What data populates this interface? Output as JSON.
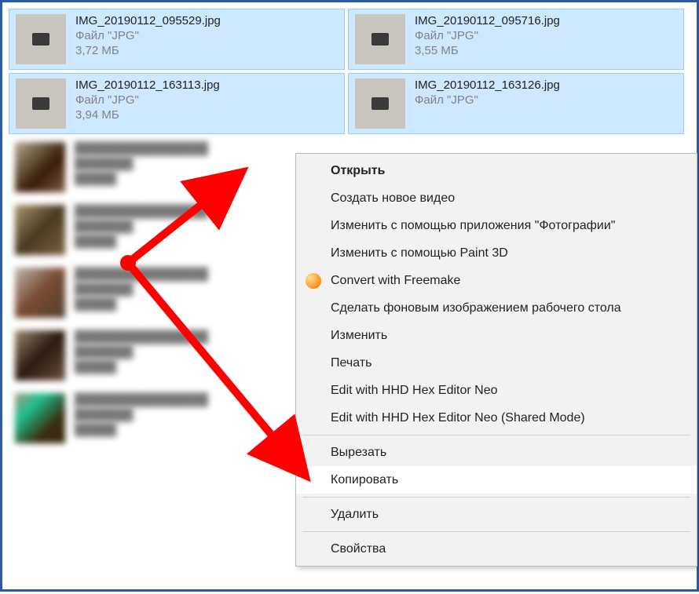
{
  "files": [
    {
      "name": "IMG_20190112_095529.jpg",
      "type": "Файл \"JPG\"",
      "size": "3,72 МБ",
      "selected": true
    },
    {
      "name": "IMG_20190112_095716.jpg",
      "type": "Файл \"JPG\"",
      "size": "3,55 МБ",
      "selected": true
    },
    {
      "name": "IMG_20190112_163113.jpg",
      "type": "Файл \"JPG\"",
      "size": "3,94 МБ",
      "selected": true
    },
    {
      "name": "IMG_20190112_163126.jpg",
      "type": "Файл \"JPG\"",
      "size": "",
      "selected": true
    }
  ],
  "context_menu": {
    "open": "Открыть",
    "new_video": "Создать новое видео",
    "photos_edit": "Изменить с помощью приложения \"Фотографии\"",
    "paint3d": "Изменить с помощью Paint 3D",
    "freemake": "Convert with Freemake",
    "set_wallpaper": "Сделать фоновым изображением рабочего стола",
    "edit": "Изменить",
    "print": "Печать",
    "hex1": "Edit with HHD Hex Editor Neo",
    "hex2": "Edit with HHD Hex Editor Neo (Shared Mode)",
    "cut": "Вырезать",
    "copy": "Копировать",
    "delete": "Удалить",
    "properties": "Свойства"
  }
}
